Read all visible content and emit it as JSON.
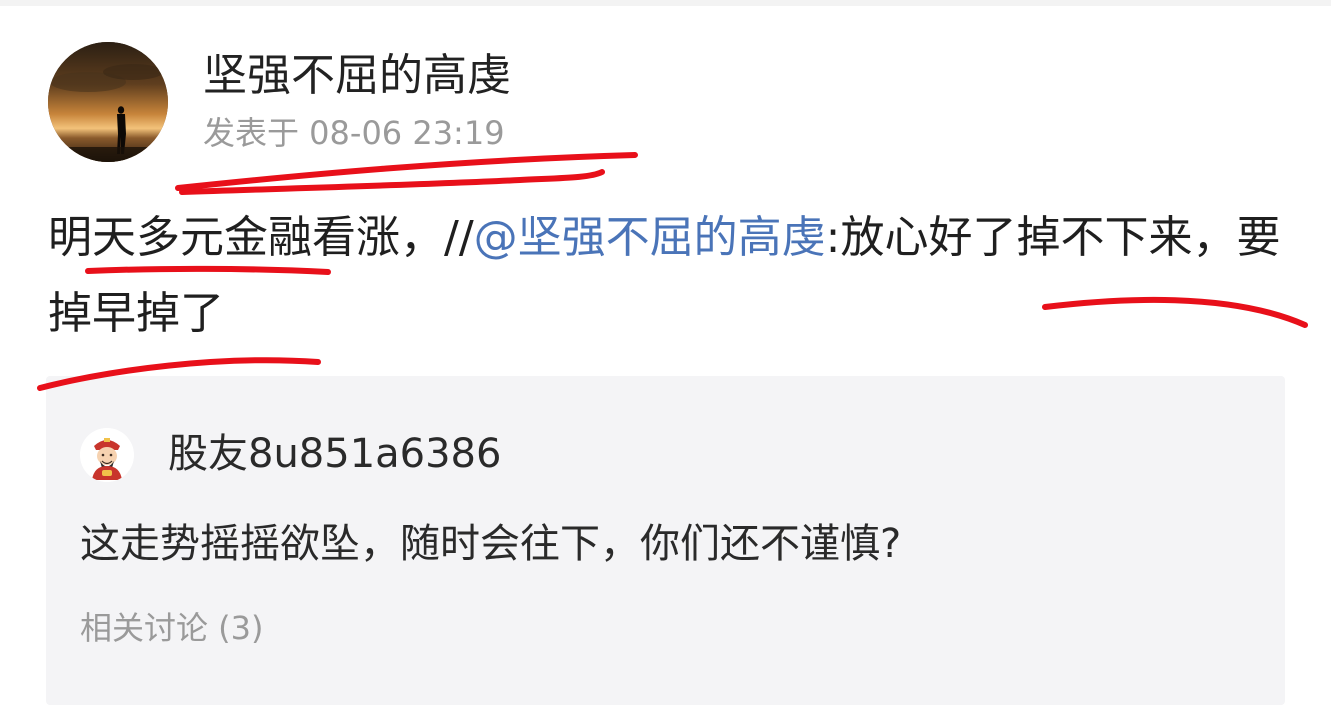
{
  "post": {
    "author": "坚强不屈的高虔",
    "timestamp": "发表于 08-06 23:19",
    "content_prefix": "明天多元金融看涨，//",
    "mention": "@坚强不屈的高虔",
    "content_suffix": ":放心好了掉不下来，要掉早掉了"
  },
  "quote": {
    "author": "股友8u851a6386",
    "text": "这走势摇摇欲坠，随时会往下，你们还不谨慎?",
    "related": "相关讨论 (3)"
  },
  "colors": {
    "mention": "#4a74b8",
    "annotation": "#e8101a",
    "quote_bg": "#f4f4f6",
    "muted": "#9a9a9a"
  },
  "icons": {
    "post_avatar": "silhouette-sunset-avatar",
    "quote_avatar": "cartoon-god-of-wealth-avatar"
  }
}
